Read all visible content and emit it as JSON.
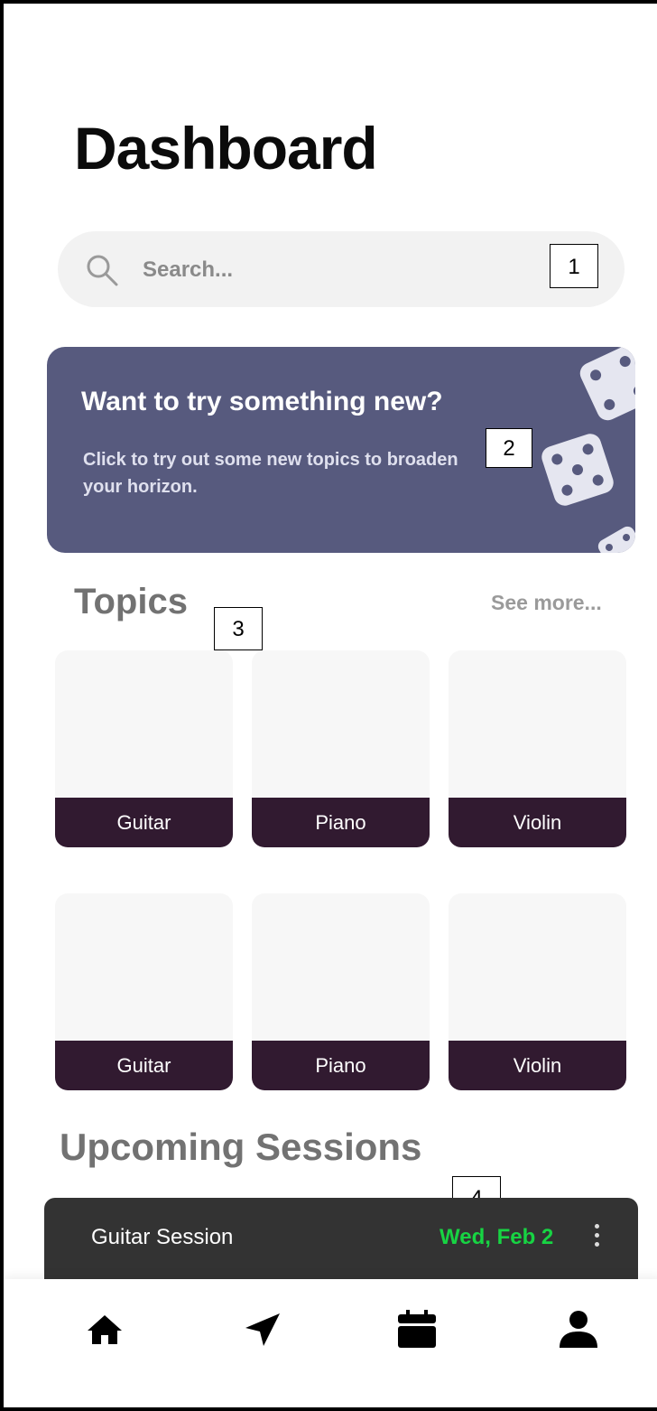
{
  "header": {
    "title": "Dashboard"
  },
  "search": {
    "placeholder": "Search..."
  },
  "annotations": [
    "1",
    "2",
    "3",
    "4"
  ],
  "banner": {
    "heading": "Want to try something new?",
    "subtext": "Click to try out some new topics to broaden your horizon.",
    "background": "#575a7e"
  },
  "topics": {
    "title": "Topics",
    "see_more": "See more...",
    "rows": [
      [
        "Guitar",
        "Piano",
        "Violin"
      ],
      [
        "Guitar",
        "Piano",
        "Violin"
      ]
    ]
  },
  "sessions": {
    "title": "Upcoming Sessions",
    "items": [
      {
        "name": "Guitar Session",
        "date": "Wed, Feb 2",
        "date_color": "#17d443"
      }
    ]
  },
  "nav": {
    "icons": [
      "home-icon",
      "send-icon",
      "calendar-icon",
      "profile-icon"
    ]
  },
  "colors": {
    "card_label": "#311a30",
    "session_card": "#333333",
    "accent_green": "#17d443"
  }
}
